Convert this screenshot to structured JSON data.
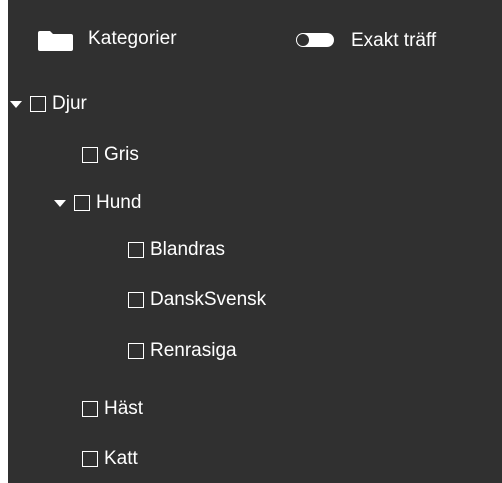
{
  "header": {
    "title": "Kategorier",
    "toggle_label": "Exakt träff",
    "toggle_state": "off"
  },
  "tree": {
    "root": {
      "label": "Djur",
      "expanded": true,
      "children": [
        {
          "label": "Gris"
        },
        {
          "label": "Hund",
          "expanded": true,
          "children": [
            {
              "label": "Blandras"
            },
            {
              "label": "DanskSvensk"
            },
            {
              "label": "Renrasiga"
            }
          ]
        },
        {
          "label": "Häst"
        },
        {
          "label": "Katt"
        }
      ]
    }
  },
  "colors": {
    "panel_background": "#303030",
    "text": "#ffffff"
  },
  "icons": {
    "header": "folder-icon",
    "expand": "caret-down-icon",
    "checkbox": "checkbox-empty-icon",
    "toggle": "toggle-off-icon"
  }
}
